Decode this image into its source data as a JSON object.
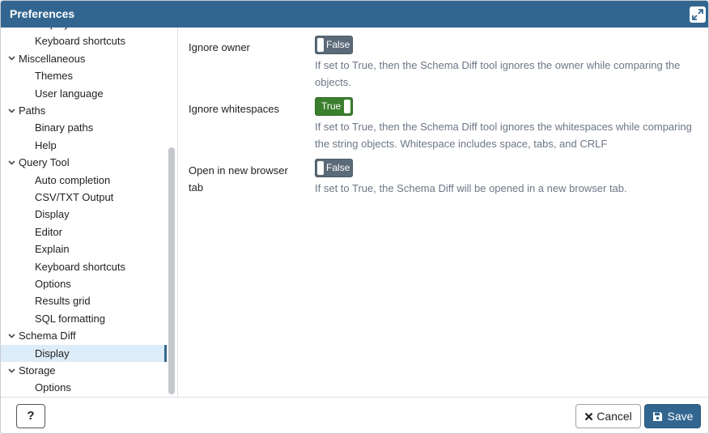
{
  "dialog": {
    "title": "Preferences"
  },
  "tree": [
    {
      "label": "Display",
      "level": "child"
    },
    {
      "label": "Keyboard shortcuts",
      "level": "child"
    },
    {
      "label": "Miscellaneous",
      "level": "group"
    },
    {
      "label": "Themes",
      "level": "child"
    },
    {
      "label": "User language",
      "level": "child"
    },
    {
      "label": "Paths",
      "level": "group"
    },
    {
      "label": "Binary paths",
      "level": "child"
    },
    {
      "label": "Help",
      "level": "child"
    },
    {
      "label": "Query Tool",
      "level": "group"
    },
    {
      "label": "Auto completion",
      "level": "child"
    },
    {
      "label": "CSV/TXT Output",
      "level": "child"
    },
    {
      "label": "Display",
      "level": "child"
    },
    {
      "label": "Editor",
      "level": "child"
    },
    {
      "label": "Explain",
      "level": "child"
    },
    {
      "label": "Keyboard shortcuts",
      "level": "child"
    },
    {
      "label": "Options",
      "level": "child"
    },
    {
      "label": "Results grid",
      "level": "child"
    },
    {
      "label": "SQL formatting",
      "level": "child"
    },
    {
      "label": "Schema Diff",
      "level": "group"
    },
    {
      "label": "Display",
      "level": "child",
      "selected": true
    },
    {
      "label": "Storage",
      "level": "group"
    },
    {
      "label": "Options",
      "level": "child"
    }
  ],
  "prefs": {
    "ignore_owner": {
      "label": "Ignore owner",
      "toggle": "False",
      "help": "If set to True, then the Schema Diff tool ignores the owner while comparing the objects."
    },
    "ignore_whitespaces": {
      "label": "Ignore whitespaces",
      "toggle": "True",
      "help": "If set to True, then the Schema Diff tool ignores the whitespaces while comparing the string objects. Whitespace includes space, tabs, and CRLF"
    },
    "open_new_tab": {
      "label": "Open in new browser tab",
      "toggle": "False",
      "help": "If set to True, the Schema Diff will be opened in a new browser tab."
    }
  },
  "footer": {
    "help_label": "?",
    "cancel_label": "Cancel",
    "save_label": "Save"
  },
  "colors": {
    "brand": "#326690",
    "toggle_on": "#3a7f2d",
    "toggle_off": "#5b6a78",
    "selected_row": "#dcecf8"
  },
  "icons": {
    "maximize": "expand-icon",
    "chevron": "chevron-down-icon",
    "cancel": "close-icon",
    "save": "floppy-disk-icon"
  }
}
